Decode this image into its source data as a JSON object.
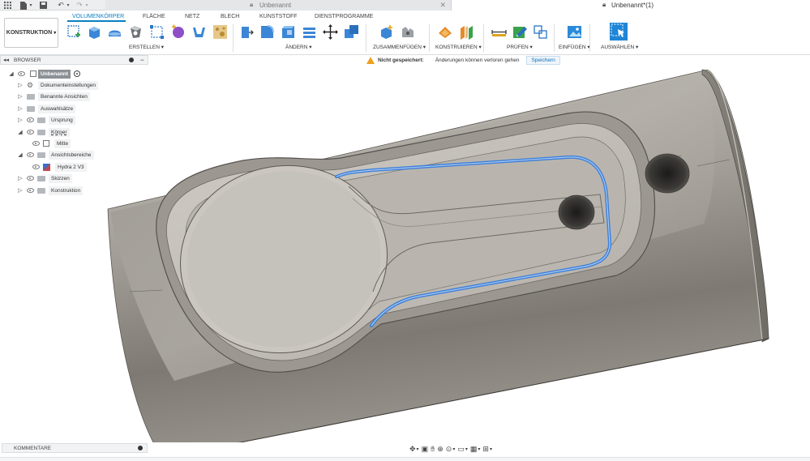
{
  "titlebar": {
    "tab_inactive": "Unbenannt",
    "tab_active": "Unbenannt*(1)"
  },
  "ribbon": {
    "workspace": "KONSTRUKTION",
    "tabs": [
      "VOLUMENKÖRPER",
      "FLÄCHE",
      "NETZ",
      "BLECH",
      "KUNSTSTOFF",
      "DIENSTPROGRAMME"
    ],
    "active_tab": "VOLUMENKÖRPER",
    "groups": {
      "erstellen": "ERSTELLEN",
      "aendern": "ÄNDERN",
      "zusammenfuegen": "ZUSAMMENFÜGEN",
      "konstruieren": "KONSTRUIEREN",
      "pruefen": "PRÜFEN",
      "einfuegen": "EINFÜGEN",
      "auswaehlen": "AUSWÄHLEN"
    }
  },
  "browser": {
    "title": "BROWSER",
    "root": "Unbenannt",
    "items": [
      {
        "label": "Dokumenteinstellungen"
      },
      {
        "label": "Benannte Ansichten"
      },
      {
        "label": "Auswahlsätze"
      },
      {
        "label": "Ursprung"
      },
      {
        "label": "Körper"
      },
      {
        "label": "Mitte"
      },
      {
        "label": "Ansichtsbereiche"
      },
      {
        "label": "Hydra 2 V3"
      },
      {
        "label": "Skizzen"
      },
      {
        "label": "Konstruktion"
      }
    ]
  },
  "notice": {
    "status": "Nicht gespeichert:",
    "message": "Änderungen können verloren gehen",
    "save_label": "Speichern"
  },
  "comments": {
    "title": "KOMMENTARE"
  },
  "colors": {
    "accent": "#0a7fc1",
    "body_dark": "#7a7670",
    "body_light": "#c8c4bd",
    "selected_edge": "#3d7fd8",
    "warning": "#f0a020"
  }
}
